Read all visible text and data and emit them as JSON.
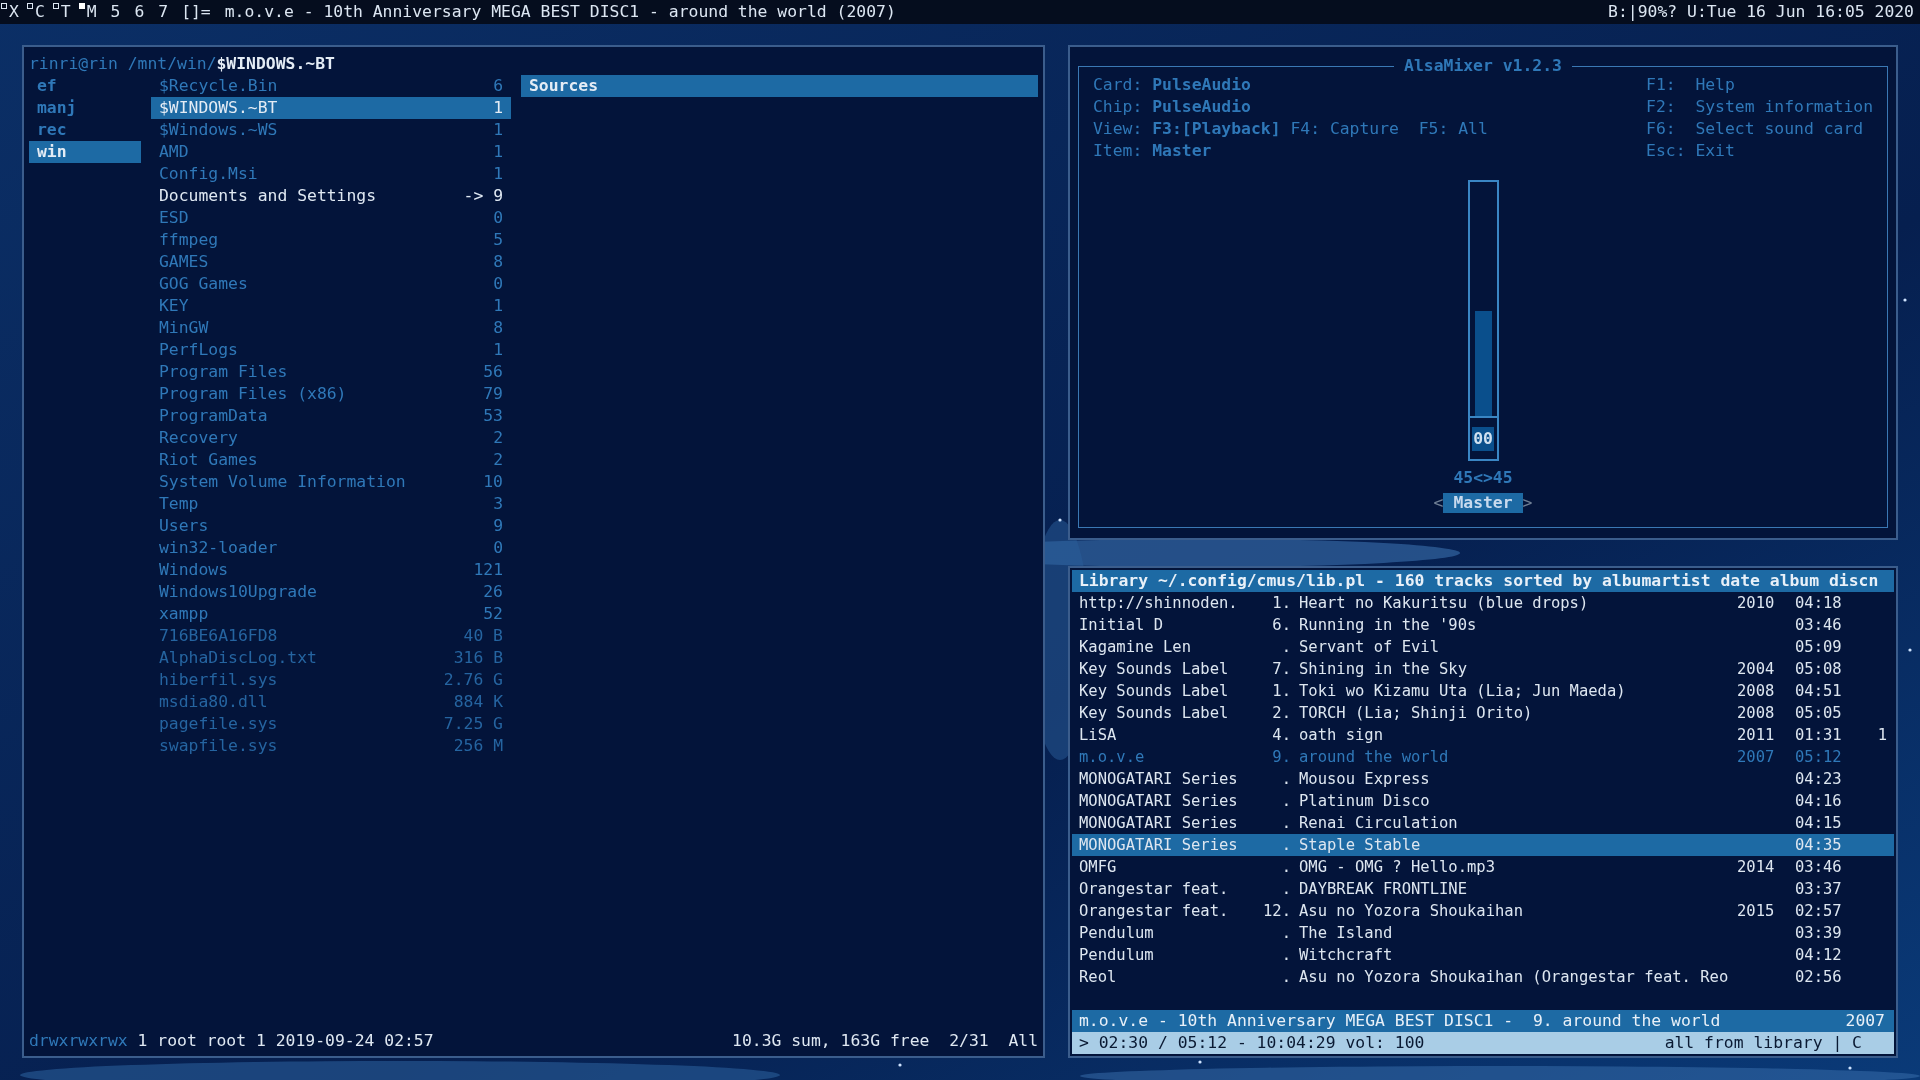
{
  "top_bar": {
    "tags": [
      {
        "label": "X",
        "occupied": true,
        "focused": false
      },
      {
        "label": "C",
        "occupied": true,
        "focused": false
      },
      {
        "label": "T",
        "occupied": true,
        "focused": false
      },
      {
        "label": "M",
        "occupied": true,
        "focused": true
      },
      {
        "label": "5",
        "occupied": false,
        "focused": false
      },
      {
        "label": "6",
        "occupied": false,
        "focused": false
      },
      {
        "label": "7",
        "occupied": false,
        "focused": false
      }
    ],
    "layout": "[]=",
    "title": "m.o.v.e - 10th Anniversary MEGA BEST DISC1 - around the world (2007)",
    "status": "B:|90%? U:Tue 16 Jun 16:05 2020"
  },
  "file_manager": {
    "user_host": "rinri@rin",
    "path": "/mnt/win/",
    "current": "$WINDOWS.~BT",
    "parent_items": [
      {
        "name": "ef",
        "selected": false
      },
      {
        "name": "manj",
        "selected": false
      },
      {
        "name": "rec",
        "selected": false
      },
      {
        "name": "win",
        "selected": true
      }
    ],
    "items": [
      {
        "name": "$Recycle.Bin",
        "size": "6",
        "kind": "dir",
        "selected": false
      },
      {
        "name": "$WINDOWS.~BT",
        "size": "1",
        "kind": "dir",
        "selected": true
      },
      {
        "name": "$Windows.~WS",
        "size": "1",
        "kind": "dir",
        "selected": false
      },
      {
        "name": "AMD",
        "size": "1",
        "kind": "dir",
        "selected": false
      },
      {
        "name": "Config.Msi",
        "size": "1",
        "kind": "dir",
        "selected": false
      },
      {
        "name": "Documents and Settings",
        "size": "9",
        "arrow": "->",
        "kind": "link",
        "selected": false
      },
      {
        "name": "ESD",
        "size": "0",
        "kind": "dir",
        "selected": false
      },
      {
        "name": "ffmpeg",
        "size": "5",
        "kind": "dir",
        "selected": false
      },
      {
        "name": "GAMES",
        "size": "8",
        "kind": "dir",
        "selected": false
      },
      {
        "name": "GOG Games",
        "size": "0",
        "kind": "dir",
        "selected": false
      },
      {
        "name": "KEY",
        "size": "1",
        "kind": "dir",
        "selected": false
      },
      {
        "name": "MinGW",
        "size": "8",
        "kind": "dir",
        "selected": false
      },
      {
        "name": "PerfLogs",
        "size": "1",
        "kind": "dir",
        "selected": false
      },
      {
        "name": "Program Files",
        "size": "56",
        "kind": "dir",
        "selected": false
      },
      {
        "name": "Program Files (x86)",
        "size": "79",
        "kind": "dir",
        "selected": false
      },
      {
        "name": "ProgramData",
        "size": "53",
        "kind": "dir",
        "selected": false
      },
      {
        "name": "Recovery",
        "size": "2",
        "kind": "dir",
        "selected": false
      },
      {
        "name": "Riot Games",
        "size": "2",
        "kind": "dir",
        "selected": false
      },
      {
        "name": "System Volume Information",
        "size": "10",
        "kind": "dir",
        "selected": false
      },
      {
        "name": "Temp",
        "size": "3",
        "kind": "dir",
        "selected": false
      },
      {
        "name": "Users",
        "size": "9",
        "kind": "dir",
        "selected": false
      },
      {
        "name": "win32-loader",
        "size": "0",
        "kind": "dir",
        "selected": false
      },
      {
        "name": "Windows",
        "size": "121",
        "kind": "dir",
        "selected": false
      },
      {
        "name": "Windows10Upgrade",
        "size": "26",
        "kind": "dir",
        "selected": false
      },
      {
        "name": "xampp",
        "size": "52",
        "kind": "dir",
        "selected": false
      },
      {
        "name": "716BE6A16FD8",
        "size": "40 B",
        "kind": "file",
        "selected": false
      },
      {
        "name": "AlphaDiscLog.txt",
        "size": "316 B",
        "kind": "file",
        "selected": false
      },
      {
        "name": "hiberfil.sys",
        "size": "2.76 G",
        "kind": "file",
        "selected": false
      },
      {
        "name": "msdia80.dll",
        "size": "884 K",
        "kind": "file",
        "selected": false
      },
      {
        "name": "pagefile.sys",
        "size": "7.25 G",
        "kind": "file",
        "selected": false
      },
      {
        "name": "swapfile.sys",
        "size": "256 M",
        "kind": "file",
        "selected": false
      }
    ],
    "preview_items": [
      {
        "name": "Sources",
        "selected": true
      }
    ],
    "status": {
      "permissions": "drwxrwxrwx",
      "info": "1 root root 1 2019-09-24 02:57",
      "disk": "10.3G sum, 163G free",
      "position": "2/31",
      "scope": "All"
    }
  },
  "mixer": {
    "title": "AlsaMixer v1.2.3",
    "info": [
      {
        "label": "Card:",
        "value": "PulseAudio"
      },
      {
        "label": "Chip:",
        "value": "PulseAudio"
      }
    ],
    "view": {
      "label": "View:",
      "options": [
        {
          "key": "F3:",
          "name": "[Playback]",
          "selected": true
        },
        {
          "key": "F4:",
          "name": "Capture",
          "selected": false
        },
        {
          "key": "F5:",
          "name": "All",
          "selected": false
        }
      ]
    },
    "item": {
      "label": "Item:",
      "value": "Master"
    },
    "keys": [
      {
        "key": "F1:",
        "action": "Help"
      },
      {
        "key": "F2:",
        "action": "System information"
      },
      {
        "key": "F6:",
        "action": "Select sound card"
      },
      {
        "key": "Esc:",
        "action": "Exit"
      }
    ],
    "control": {
      "level": 0.45,
      "mute_value": "00",
      "reading": "45<>45",
      "name": "Master",
      "left_mark": "<",
      "right_mark": ">",
      "selected": true
    }
  },
  "player": {
    "header": "Library ~/.config/cmus/lib.pl - 160 tracks sorted by albumartist date album discn",
    "tracks": [
      {
        "artist": "http://shinnoden.",
        "track": "1.",
        "title": "Heart no Kakuritsu (blue drops)",
        "year": "2010",
        "duration": "04:18",
        "playing": false,
        "selected": false
      },
      {
        "artist": "Initial D",
        "track": "6.",
        "title": "Running in the '90s",
        "duration": "03:46",
        "playing": false,
        "selected": false
      },
      {
        "artist": "Kagamine Len",
        "track": ".",
        "title": "Servant of Evil",
        "duration": "05:09",
        "playing": false,
        "selected": false
      },
      {
        "artist": "Key Sounds Label",
        "track": "7.",
        "title": "Shining in the Sky",
        "year": "2004",
        "duration": "05:08",
        "playing": false,
        "selected": false
      },
      {
        "artist": "Key Sounds Label",
        "track": "1.",
        "title": "Toki wo Kizamu Uta (Lia; Jun Maeda)",
        "year": "2008",
        "duration": "04:51",
        "playing": false,
        "selected": false
      },
      {
        "artist": "Key Sounds Label",
        "track": "2.",
        "title": "TORCH (Lia; Shinji Orito)",
        "year": "2008",
        "duration": "05:05",
        "playing": false,
        "selected": false
      },
      {
        "artist": "LiSA",
        "track": "4.",
        "title": "oath sign",
        "year": "2011",
        "duration": "01:31",
        "extra": "1",
        "playing": false,
        "selected": false
      },
      {
        "artist": "m.o.v.e",
        "track": "9.",
        "title": "around the world",
        "year": "2007",
        "duration": "05:12",
        "playing": true,
        "selected": false
      },
      {
        "artist": "MONOGATARI Series",
        "track": ".",
        "title": "Mousou Express",
        "duration": "04:23",
        "playing": false,
        "selected": false
      },
      {
        "artist": "MONOGATARI Series",
        "track": ".",
        "title": "Platinum Disco",
        "duration": "04:16",
        "playing": false,
        "selected": false
      },
      {
        "artist": "MONOGATARI Series",
        "track": ".",
        "title": "Renai Circulation",
        "duration": "04:15",
        "playing": false,
        "selected": false
      },
      {
        "artist": "MONOGATARI Series",
        "track": ".",
        "title": "Staple Stable",
        "duration": "04:35",
        "playing": false,
        "selected": true
      },
      {
        "artist": "OMFG",
        "track": ".",
        "title": "OMG - OMG ? Hello.mp3",
        "year": "2014",
        "duration": "03:46",
        "playing": false,
        "selected": false
      },
      {
        "artist": "Orangestar feat.",
        "track": ".",
        "title": "DAYBREAK FRONTLINE",
        "duration": "03:37",
        "playing": false,
        "selected": false
      },
      {
        "artist": "Orangestar feat.",
        "track": "12.",
        "title": "Asu no Yozora Shoukaihan",
        "year": "2015",
        "duration": "02:57",
        "playing": false,
        "selected": false
      },
      {
        "artist": "Pendulum",
        "track": ".",
        "title": "The Island",
        "duration": "03:39",
        "playing": false,
        "selected": false
      },
      {
        "artist": "Pendulum",
        "track": ".",
        "title": "Witchcraft",
        "duration": "04:12",
        "playing": false,
        "selected": false
      },
      {
        "artist": "Reol",
        "track": ".",
        "title": "Asu no Yozora Shoukaihan (Orangestar feat. Reo",
        "duration": "02:56",
        "playing": false,
        "selected": false
      }
    ],
    "now_playing": {
      "text": "m.o.v.e - 10th Anniversary MEGA BEST DISC1 -  9. around the world",
      "year": "2007"
    },
    "status": {
      "position": "> 02:30 / 05:12 - 10:04:29 vol: 100",
      "mode": "all from library | C"
    }
  }
}
